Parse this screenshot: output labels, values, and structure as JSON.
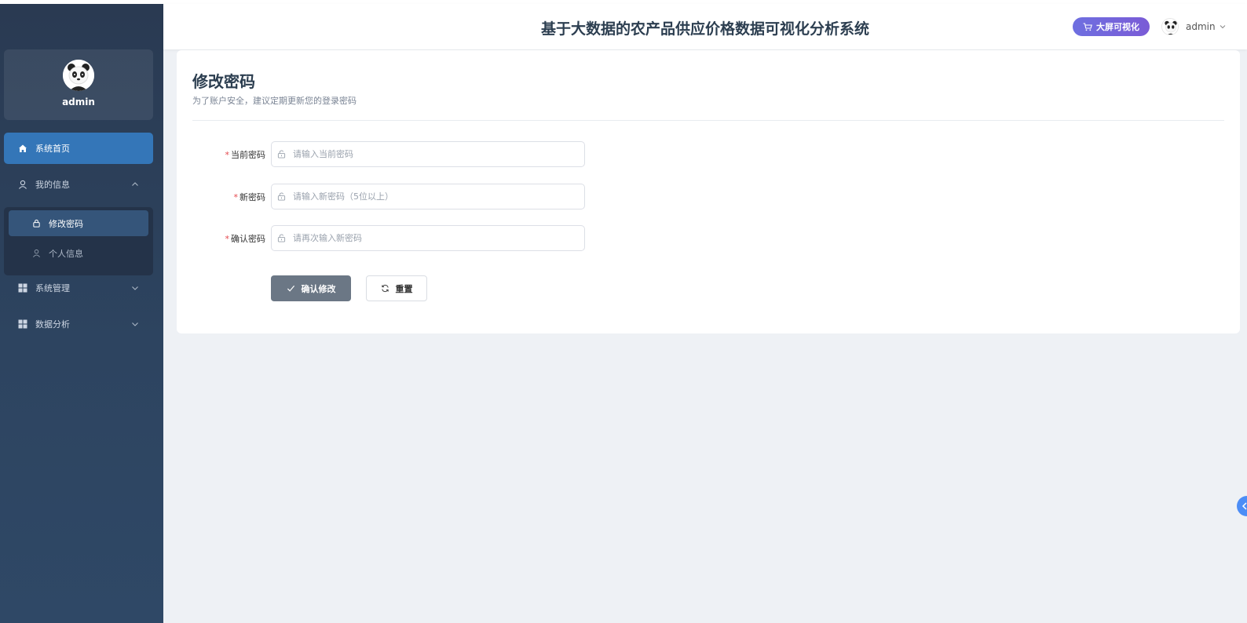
{
  "sidebar": {
    "user": {
      "name": "admin"
    },
    "items": [
      {
        "label": "系统首页",
        "icon": "home-icon",
        "active": true
      },
      {
        "label": "我的信息",
        "icon": "user-icon",
        "expanded": true,
        "children": [
          {
            "label": "修改密码",
            "icon": "lock-icon",
            "active": true
          },
          {
            "label": "个人信息",
            "icon": "user-icon",
            "active": false
          }
        ]
      },
      {
        "label": "系统管理",
        "icon": "grid-icon",
        "expanded": false
      },
      {
        "label": "数据分析",
        "icon": "grid-icon",
        "expanded": false
      }
    ]
  },
  "header": {
    "title": "基于大数据的农产品供应价格数据可视化分析系统",
    "big_screen_label": "大屏可视化",
    "user_name": "admin"
  },
  "page": {
    "title": "修改密码",
    "subtitle": "为了账户安全，建议定期更新您的登录密码",
    "fields": [
      {
        "label": "当前密码",
        "placeholder": "请输入当前密码",
        "value": ""
      },
      {
        "label": "新密码",
        "placeholder": "请输入新密码（5位以上）",
        "value": ""
      },
      {
        "label": "确认密码",
        "placeholder": "请再次输入新密码",
        "value": ""
      }
    ],
    "required_mark": "*",
    "confirm_label": "确认修改",
    "reset_label": "重置"
  },
  "colors": {
    "sidebar_active": "#3476b8",
    "big_screen_button": "#7063dc",
    "primary_button": "#6b7785",
    "required": "#e5484d"
  }
}
